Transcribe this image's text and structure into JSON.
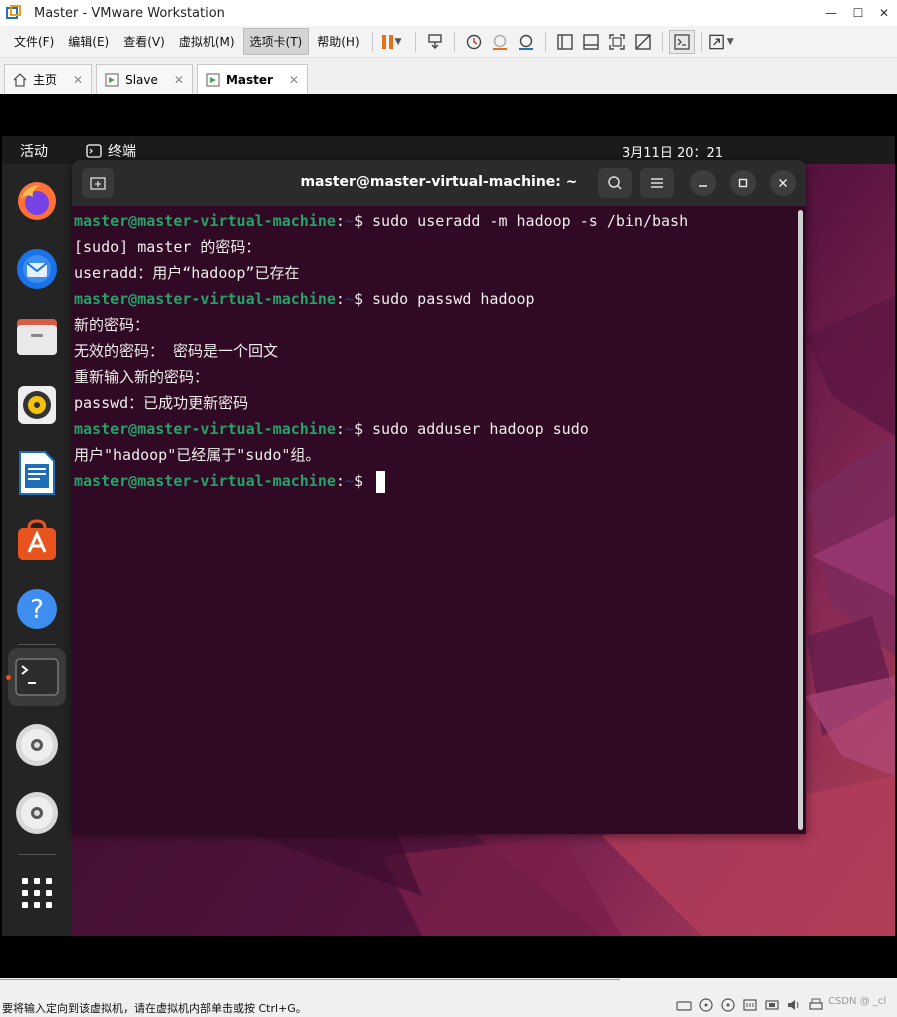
{
  "window": {
    "title": "Master - VMware Workstation",
    "minimize_glyph": "—",
    "maximize_glyph": "☐",
    "close_glyph": "✕"
  },
  "menu": [
    {
      "label": "文件(F)"
    },
    {
      "label": "编辑(E)"
    },
    {
      "label": "查看(V)"
    },
    {
      "label": "虚拟机(M)"
    },
    {
      "label": "选项卡(T)"
    },
    {
      "label": "帮助(H)"
    }
  ],
  "tabs": [
    {
      "label": "主页",
      "icon": "home-icon"
    },
    {
      "label": "Slave",
      "icon": "vm-icon"
    },
    {
      "label": "Master",
      "icon": "vm-icon",
      "active": true
    }
  ],
  "tab_close_glyph": "✕",
  "ubuntu": {
    "activities": "活动",
    "app_name": "终端",
    "clock": "3月11日  20：21"
  },
  "terminal": {
    "title": "master@master-virtual-machine: ~",
    "prompt_user": "master@master-virtual-machine",
    "prompt_sep": ":",
    "prompt_path": "~",
    "prompt_dollar": "$ ",
    "lines": [
      {
        "prompt": true,
        "text": "sudo useradd -m hadoop -s /bin/bash"
      },
      {
        "prompt": false,
        "text": "[sudo] master 的密码："
      },
      {
        "prompt": false,
        "text": "useradd：用户“hadoop”已存在"
      },
      {
        "prompt": true,
        "text": "sudo passwd hadoop"
      },
      {
        "prompt": false,
        "text": "新的密码："
      },
      {
        "prompt": false,
        "text": "无效的密码： 密码是一个回文"
      },
      {
        "prompt": false,
        "text": "重新输入新的密码："
      },
      {
        "prompt": false,
        "text": "passwd：已成功更新密码"
      },
      {
        "prompt": true,
        "text": "sudo adduser hadoop sudo"
      },
      {
        "prompt": false,
        "text": "用户\"hadoop\"已经属于\"sudo\"组。"
      },
      {
        "prompt": true,
        "text": ""
      }
    ]
  },
  "dock": [
    {
      "name": "firefox-icon"
    },
    {
      "name": "thunderbird-icon"
    },
    {
      "name": "files-icon"
    },
    {
      "name": "rhythmbox-icon"
    },
    {
      "name": "libreoffice-writer-icon"
    },
    {
      "name": "app-center-icon"
    },
    {
      "name": "help-icon"
    },
    {
      "name": "terminal-icon",
      "running": true
    },
    {
      "name": "dvd-icon"
    },
    {
      "name": "dvd-icon"
    },
    {
      "name": "show-apps-icon"
    }
  ],
  "status": {
    "text": "要将输入定向到该虚拟机，请在虚拟机内部单击或按 Ctrl+G。",
    "watermark": "CSDN @ _cl"
  },
  "colors": {
    "terminal_bg": "#300a24",
    "prompt_user": "#26a269",
    "prompt_path": "#12488b",
    "pause_orange": "#e8701a",
    "ubuntu_orange": "#e9541e"
  }
}
